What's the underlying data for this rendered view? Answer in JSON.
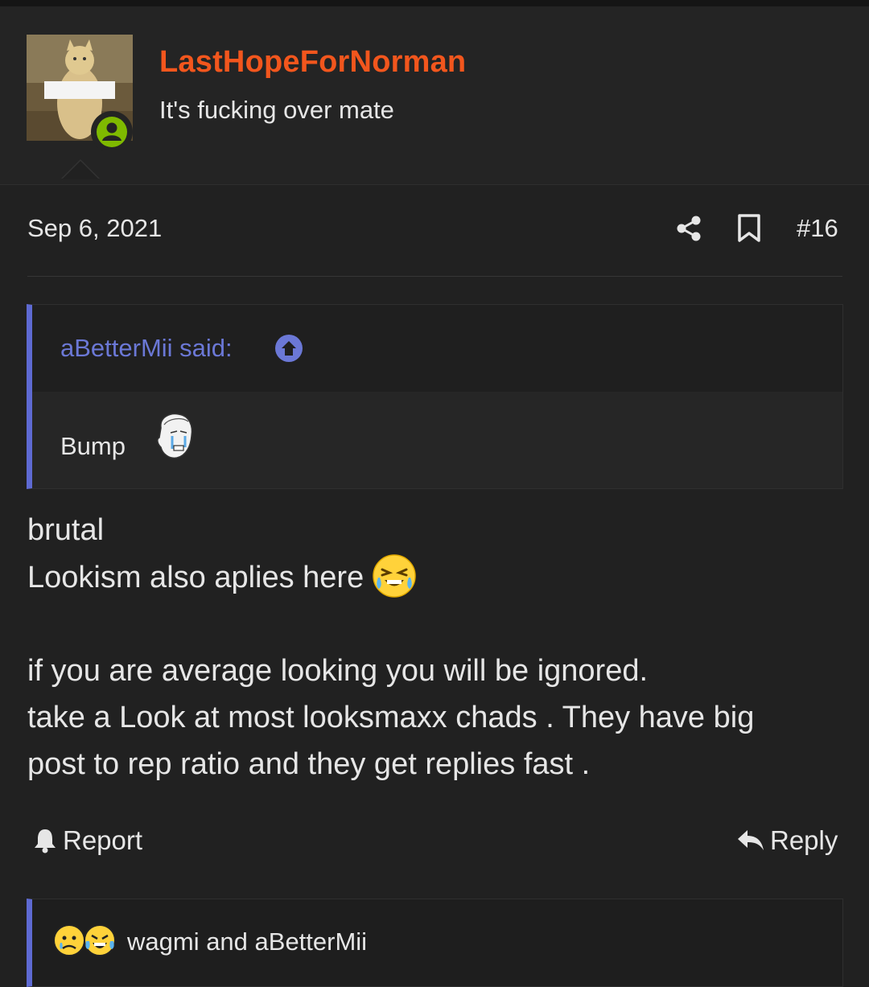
{
  "user": {
    "username": "LastHopeForNorman",
    "title": "It's fucking over mate",
    "status": "online"
  },
  "post": {
    "date": "Sep 6, 2021",
    "number": "#16",
    "quote": {
      "author": "aBetterMii said:",
      "text": "Bump"
    },
    "body_lines": [
      "brutal",
      "Lookism also aplies here",
      "",
      "if you are average looking you will be ignored.",
      "take a Look at most looksmaxx chads . They have big",
      "post to rep ratio and they get replies fast ."
    ]
  },
  "actions": {
    "report": "Report",
    "reply": "Reply"
  },
  "reactions": {
    "text": "wagmi and aBetterMii"
  },
  "colors": {
    "background": "#212121",
    "username": "#f2561d",
    "accent": "#5e6ad2",
    "online": "#7fba00"
  }
}
